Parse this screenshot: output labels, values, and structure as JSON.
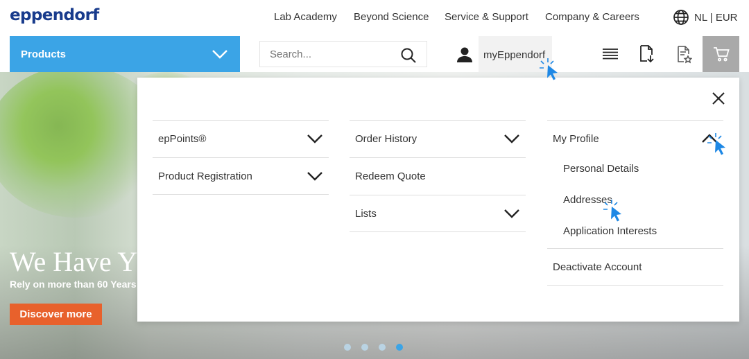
{
  "header": {
    "logo": "eppendorf",
    "nav": [
      "Lab Academy",
      "Beyond Science",
      "Service & Support",
      "Company & Careers"
    ],
    "locale": "NL | EUR"
  },
  "subbar": {
    "products_label": "Products",
    "search_placeholder": "Search...",
    "account_label": "myEppendorf"
  },
  "hero": {
    "title": "We Have Y",
    "subtitle": "Rely on more than 60 Years",
    "cta": "Discover more"
  },
  "menu": {
    "col1": [
      "epPoints®",
      "Product Registration"
    ],
    "col2": [
      "Order History",
      "Redeem Quote",
      "Lists"
    ],
    "col3": {
      "my_profile": "My Profile",
      "sub": [
        "Personal Details",
        "Addresses",
        "Application Interests"
      ],
      "deactivate": "Deactivate Account"
    }
  },
  "colors": {
    "brand": "#183b8c",
    "products_bg": "#3ba4e6",
    "cta": "#e8612c",
    "cart_bg": "#a9a9a9",
    "cursor": "#1e88e5"
  }
}
